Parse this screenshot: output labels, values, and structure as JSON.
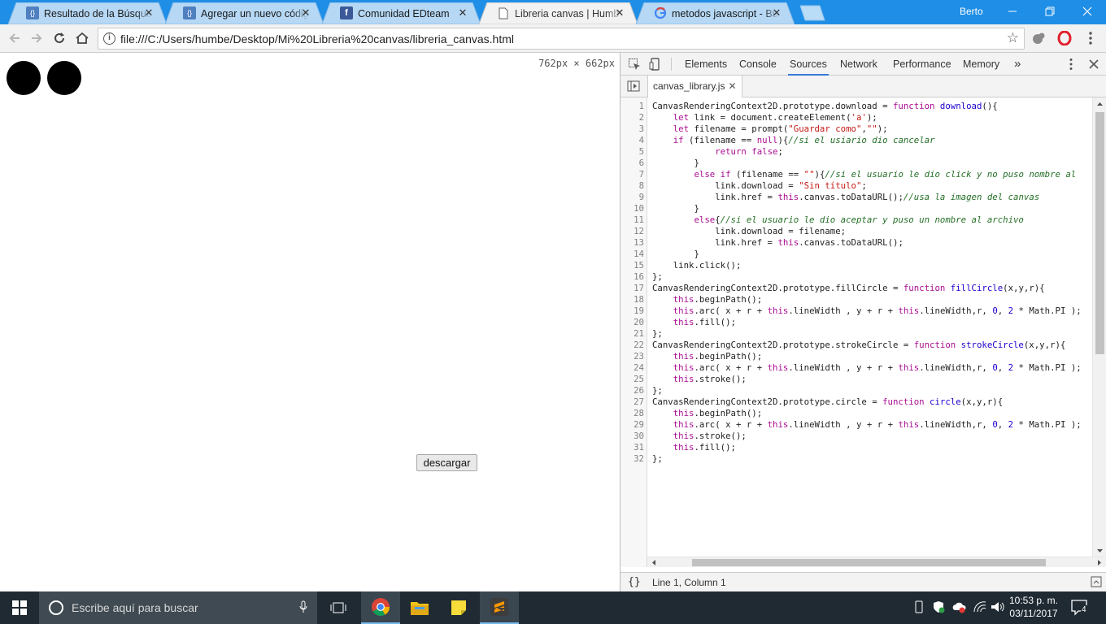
{
  "browser": {
    "tabs": [
      {
        "title": "Resultado de la Búsqueda",
        "favicon": "page-brackets-icon",
        "active": false
      },
      {
        "title": "Agregar un nuevo código",
        "favicon": "page-brackets-icon",
        "active": false
      },
      {
        "title": "Comunidad EDteam",
        "favicon": "facebook-icon",
        "active": false
      },
      {
        "title": "Libreria canvas | Humberto",
        "favicon": "document-icon",
        "active": true
      },
      {
        "title": "metodos javascript - Buscar",
        "favicon": "google-icon",
        "active": false
      }
    ],
    "profile_name": "Berto",
    "url": "file:///C:/Users/humbe/Desktop/Mi%20Libreria%20canvas/libreria_canvas.html",
    "accent": "#1f8ee6"
  },
  "page": {
    "dimensions_label": "762px  ×  662px",
    "download_button": "descargar"
  },
  "devtools": {
    "tabs": [
      "Elements",
      "Console",
      "Sources",
      "Network",
      "Performance",
      "Memory"
    ],
    "active_tab": "Sources",
    "more_tabs": "»",
    "file_tab": "canvas_library.js",
    "status": "Line 1, Column 1",
    "status_icon": "{}",
    "code": [
      {
        "n": "1",
        "html": "CanvasRenderingContext2D.prototype.download = <span class=\"kw\">function</span> <span class=\"fn\">download</span>(){"
      },
      {
        "n": "2",
        "html": "    <span class=\"kw\">let</span> link = document.createElement(<span class=\"str\">'a'</span>);"
      },
      {
        "n": "3",
        "html": "    <span class=\"kw\">let</span> filename = prompt(<span class=\"str\">\"Guardar como\"</span>,<span class=\"str\">\"\"</span>);"
      },
      {
        "n": "4",
        "html": "    <span class=\"kw\">if</span> (filename == <span class=\"kw\">null</span>){<span class=\"cm\">//si el usiario dio cancelar</span>"
      },
      {
        "n": "5",
        "html": "            <span class=\"kw\">return</span> <span class=\"kw\">false</span>;"
      },
      {
        "n": "6",
        "html": "        }"
      },
      {
        "n": "7",
        "html": "        <span class=\"kw\">else</span> <span class=\"kw\">if</span> (filename == <span class=\"str\">\"\"</span>){<span class=\"cm\">//si el usuario le dio click y no puso nombre al</span>"
      },
      {
        "n": "8",
        "html": "            link.download = <span class=\"str\">\"Sin título\"</span>;"
      },
      {
        "n": "9",
        "html": "            link.href = <span class=\"kw\">this</span>.canvas.toDataURL();<span class=\"cm\">//usa la imagen del canvas</span>"
      },
      {
        "n": "10",
        "html": "        }"
      },
      {
        "n": "11",
        "html": "        <span class=\"kw\">else</span>{<span class=\"cm\">//si el usuario le dio aceptar y puso un nombre al archivo</span>"
      },
      {
        "n": "12",
        "html": "            link.download = filename;"
      },
      {
        "n": "13",
        "html": "            link.href = <span class=\"kw\">this</span>.canvas.toDataURL();"
      },
      {
        "n": "14",
        "html": "        }"
      },
      {
        "n": "15",
        "html": "    link.click();"
      },
      {
        "n": "16",
        "html": "};"
      },
      {
        "n": "17",
        "html": "CanvasRenderingContext2D.prototype.fillCircle = <span class=\"kw\">function</span> <span class=\"fn\">fillCircle</span>(x,y,r){"
      },
      {
        "n": "18",
        "html": "    <span class=\"kw\">this</span>.beginPath();"
      },
      {
        "n": "19",
        "html": "    <span class=\"kw\">this</span>.arc( x + r + <span class=\"kw\">this</span>.lineWidth , y + r + <span class=\"kw\">this</span>.lineWidth,r, <span class=\"num\">0</span>, <span class=\"num\">2</span> * Math.PI );"
      },
      {
        "n": "20",
        "html": "    <span class=\"kw\">this</span>.fill();"
      },
      {
        "n": "21",
        "html": "};"
      },
      {
        "n": "22",
        "html": "CanvasRenderingContext2D.prototype.strokeCircle = <span class=\"kw\">function</span> <span class=\"fn\">strokeCircle</span>(x,y,r){"
      },
      {
        "n": "23",
        "html": "    <span class=\"kw\">this</span>.beginPath();"
      },
      {
        "n": "24",
        "html": "    <span class=\"kw\">this</span>.arc( x + r + <span class=\"kw\">this</span>.lineWidth , y + r + <span class=\"kw\">this</span>.lineWidth,r, <span class=\"num\">0</span>, <span class=\"num\">2</span> * Math.PI );"
      },
      {
        "n": "25",
        "html": "    <span class=\"kw\">this</span>.stroke();"
      },
      {
        "n": "26",
        "html": "};"
      },
      {
        "n": "27",
        "html": "CanvasRenderingContext2D.prototype.circle = <span class=\"kw\">function</span> <span class=\"fn\">circle</span>(x,y,r){"
      },
      {
        "n": "28",
        "html": "    <span class=\"kw\">this</span>.beginPath();"
      },
      {
        "n": "29",
        "html": "    <span class=\"kw\">this</span>.arc( x + r + <span class=\"kw\">this</span>.lineWidth , y + r + <span class=\"kw\">this</span>.lineWidth,r, <span class=\"num\">0</span>, <span class=\"num\">2</span> * Math.PI );"
      },
      {
        "n": "30",
        "html": "    <span class=\"kw\">this</span>.stroke();"
      },
      {
        "n": "31",
        "html": "    <span class=\"kw\">this</span>.fill();"
      },
      {
        "n": "32",
        "html": "};"
      }
    ]
  },
  "taskbar": {
    "search_placeholder": "Escribe aquí para buscar",
    "time": "10:53 p. m.",
    "date": "03/11/2017",
    "notification_count": "4"
  }
}
